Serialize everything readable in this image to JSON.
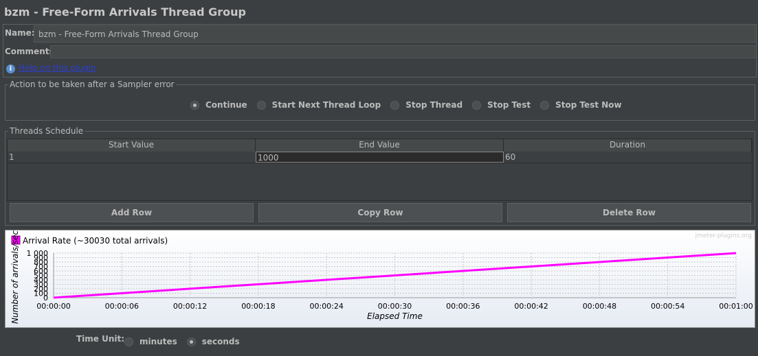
{
  "title": "bzm - Free-Form Arrivals Thread Group",
  "name_label": "Name:",
  "name_value": "bzm - Free-Form Arrivals Thread Group",
  "comments_label": "Comments:",
  "comments_value": "",
  "help_link": "Help on this plugin",
  "error_action": {
    "legend": "Action to be taken after a Sampler error",
    "options": [
      "Continue",
      "Start Next Thread Loop",
      "Stop Thread",
      "Stop Test",
      "Stop Test Now"
    ],
    "selected": "Continue"
  },
  "schedule": {
    "legend": "Threads Schedule",
    "columns": [
      "Start Value",
      "End Value",
      "Duration"
    ],
    "rows": [
      [
        "1",
        "1000",
        "60"
      ]
    ],
    "buttons": [
      "Add Row",
      "Copy Row",
      "Delete Row"
    ]
  },
  "chart_data": {
    "type": "line",
    "watermark": "jmeter-plugins.org",
    "legend": "Arrival Rate (~30030 total arrivals)",
    "legend_color": "#ff00ff",
    "xlabel": "Elapsed Time",
    "ylabel": "Number of arrivals/sec",
    "x_ticks": [
      "00:00:00",
      "00:00:06",
      "00:00:12",
      "00:00:18",
      "00:00:24",
      "00:00:30",
      "00:00:36",
      "00:00:42",
      "00:00:48",
      "00:00:54",
      "00:01:00"
    ],
    "y_ticks": [
      "0",
      "100",
      "200",
      "300",
      "400",
      "500",
      "600",
      "700",
      "800",
      "900",
      "1 000"
    ],
    "xlim": [
      0,
      60
    ],
    "ylim": [
      0,
      1000
    ],
    "grid": true,
    "series": [
      {
        "x": [
          0,
          60
        ],
        "y": [
          1,
          1000
        ]
      }
    ]
  },
  "time_unit": {
    "label": "Time Unit:",
    "options": [
      "minutes",
      "seconds"
    ],
    "selected": "seconds"
  }
}
